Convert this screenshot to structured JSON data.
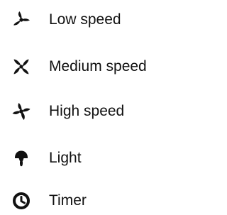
{
  "legend": {
    "items": [
      {
        "icon": "fan-low-icon",
        "label": "Low speed"
      },
      {
        "icon": "fan-medium-icon",
        "label": "Medium speed"
      },
      {
        "icon": "fan-high-icon",
        "label": "High speed"
      },
      {
        "icon": "light-bulb-icon",
        "label": "Light"
      },
      {
        "icon": "clock-icon",
        "label": "Timer"
      }
    ]
  },
  "colors": {
    "icon": "#111111",
    "text": "#111111",
    "background": "#ffffff"
  }
}
